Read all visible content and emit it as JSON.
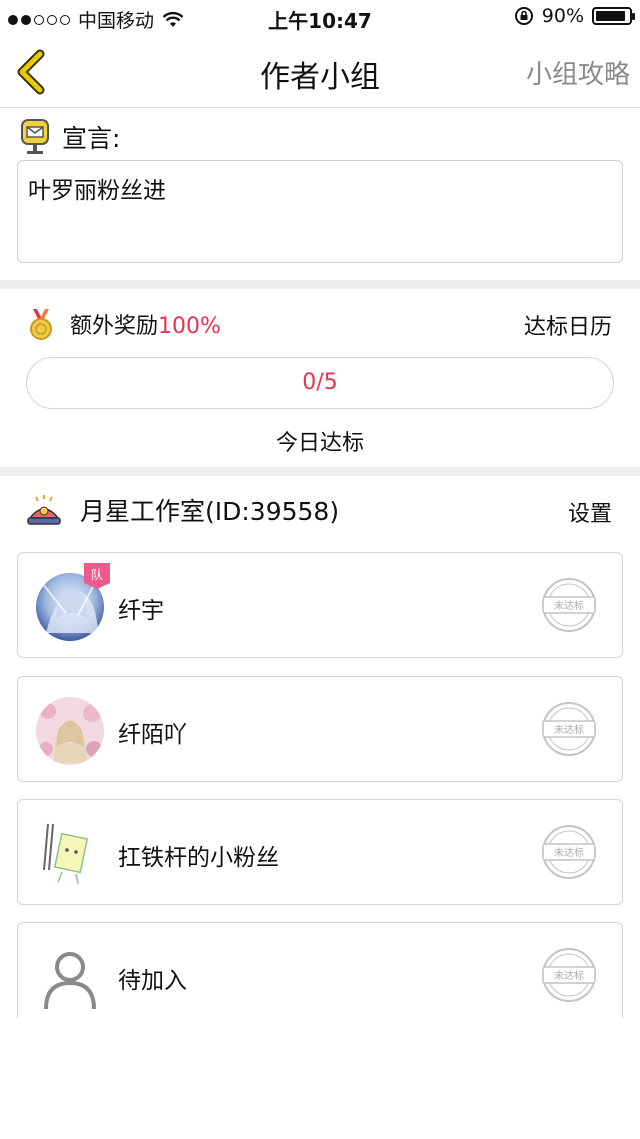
{
  "status_bar": {
    "carrier": "中国移动",
    "time": "上午10:47",
    "battery": "90%",
    "battery_level": 0.9
  },
  "nav": {
    "title": "作者小组",
    "right_link": "小组攻略"
  },
  "declaration": {
    "label": "宣言:",
    "text": "叶罗丽粉丝进"
  },
  "reward": {
    "label": "额外奖励",
    "percent": "100%",
    "calendar_link": "达标日历",
    "progress_text": "0/5",
    "progress_value": 0,
    "progress_max": 5,
    "today_label": "今日达标"
  },
  "group": {
    "title": "月星工作室(ID:39558)",
    "settings_link": "设置"
  },
  "members": [
    {
      "name": "纤宇",
      "badge": "队",
      "stamp": "未达标"
    },
    {
      "name": "纤陌吖",
      "stamp": "未达标"
    },
    {
      "name": "扛铁杆的小粉丝",
      "stamp": "未达标"
    },
    {
      "name": "待加入",
      "stamp": "未达标"
    }
  ],
  "colors": {
    "accent_red": "#e8344e",
    "back_arrow": "#d9b600",
    "secondary_text": "#8a8a8a"
  }
}
